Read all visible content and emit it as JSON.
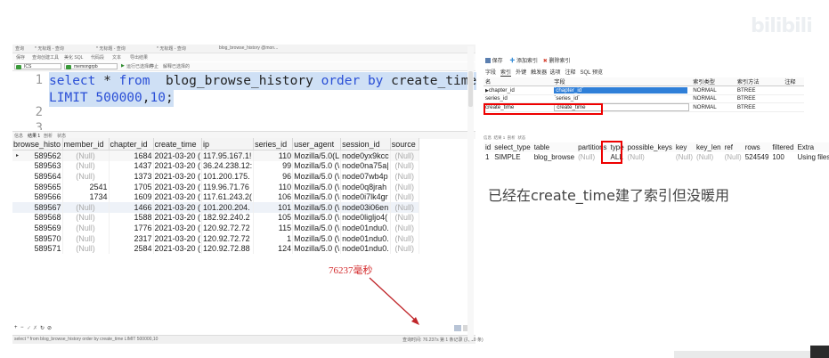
{
  "window_tabs": [
    "查询",
    "* 无标题 - 查询",
    "* 无标题 - 查询",
    "* 无标题 - 查询",
    "blog_browse_history @mon..."
  ],
  "toolbar1_items": [
    "保存",
    "查询创建工具",
    "美化 SQL",
    "代码段",
    "文本",
    "导出结果"
  ],
  "toolbar2": {
    "connection": "ICS",
    "database": "memongrpb",
    "run_label": "运行已选择的",
    "stop_label": "停止",
    "explain_label": "解释已选择的"
  },
  "editor": {
    "line_numbers": [
      "1",
      "",
      "2",
      "3"
    ],
    "line1": [
      "select",
      " * ",
      "from",
      "  blog_browse_history ",
      "order by",
      " create_time"
    ],
    "line1_wrap": [
      "LIMIT ",
      "500000",
      ",",
      "10",
      ";"
    ]
  },
  "result_tabs": [
    "信息",
    "结果 1",
    "剖析",
    "状态"
  ],
  "grid": {
    "columns": [
      "browse_histo",
      "member_id",
      "chapter_id",
      "create_time",
      "ip",
      "series_id",
      "user_agent",
      "session_id",
      "source"
    ],
    "rows": [
      [
        "589562",
        "(Null)",
        "1684",
        "2021-03-20 (",
        "117.95.167.1!",
        "110",
        "Mozilla/5.0(L",
        "node0yx9kcc",
        "(Null)"
      ],
      [
        "589563",
        "(Null)",
        "1437",
        "2021-03-20 (",
        "36.24.238.12:",
        "99",
        "Mozilla/5.0 (\\",
        "node0na75a|",
        "(Null)"
      ],
      [
        "589564",
        "(Null)",
        "1373",
        "2021-03-20 (",
        "101.200.175.",
        "96",
        "Mozilla/5.0 (\\",
        "node07wb4p",
        "(Null)"
      ],
      [
        "589565",
        "2541",
        "1705",
        "2021-03-20 (",
        "119.96.71.76",
        "110",
        "Mozilla/5.0 (\\",
        "node0q8jrah",
        "(Null)"
      ],
      [
        "589566",
        "1734",
        "1609",
        "2021-03-20 (",
        "117.61.243.2(",
        "106",
        "Mozilla/5.0 (\\",
        "node0i7lk4gr",
        "(Null)"
      ],
      [
        "589567",
        "(Null)",
        "1466",
        "2021-03-20 (",
        "101.200.204.",
        "101",
        "Mozilla/5.0 (\\",
        "node03i06en",
        "(Null)"
      ],
      [
        "589568",
        "(Null)",
        "1588",
        "2021-03-20 (",
        "182.92.240.2",
        "105",
        "Mozilla/5.0 (\\",
        "node0ligljo4(",
        "(Null)"
      ],
      [
        "589569",
        "(Null)",
        "1776",
        "2021-03-20 (",
        "120.92.72.72",
        "115",
        "Mozilla/5.0 (\\",
        "node01ndu0.",
        "(Null)"
      ],
      [
        "589570",
        "(Null)",
        "2317",
        "2021-03-20 (",
        "120.92.72.72",
        "1",
        "Mozilla/5.0 (\\",
        "node01ndu0.",
        "(Null)"
      ],
      [
        "589571",
        "(Null)",
        "2584",
        "2021-03-20 (",
        "120.92.72.88",
        "124",
        "Mozilla/5.0 (\\",
        "node01ndu0.",
        "(Null)"
      ]
    ]
  },
  "timing_annotation": "76237毫秒",
  "statusbar": {
    "sql": "select * from  blog_browse_history order by create_time LIMIT 500000,10",
    "query_time": "查询时间: 76.237s",
    "record": "第 1 条记录 (共 10 条)"
  },
  "right_toolbar": [
    "保存",
    "添加索引",
    "删除索引"
  ],
  "right_tabs": [
    "字段",
    "索引",
    "外键",
    "触发器",
    "选项",
    "注释",
    "SQL 预览"
  ],
  "index_table": {
    "columns": [
      "名",
      "字段",
      "索引类型",
      "索引方法",
      "注释"
    ],
    "rows": [
      [
        "chapter_id",
        "`chapter_id`",
        "NORMAL",
        "BTREE",
        ""
      ],
      [
        "series_id",
        "`series_id`",
        "NORMAL",
        "BTREE",
        ""
      ],
      [
        "create_time",
        "`create_time`",
        "NORMAL",
        "BTREE",
        ""
      ]
    ]
  },
  "explain_tabs": [
    "信息",
    "结果 1",
    "剖析",
    "状态"
  ],
  "explain": {
    "columns": [
      "id",
      "select_type",
      "table",
      "partitions",
      "type",
      "possible_keys",
      "key",
      "key_len",
      "ref",
      "rows",
      "filtered",
      "Extra"
    ],
    "rows": [
      [
        "1",
        "SIMPLE",
        "blog_browse",
        "(Null)",
        "ALL",
        "(Null)",
        "(Null)",
        "(Null)",
        "(Null)",
        "524549",
        "100",
        "Using filesort"
      ]
    ]
  },
  "note": "已经在create_time建了索引但没暖用",
  "watermark": "bilibili",
  "colors": {
    "keyword": "#2a4fd6",
    "selection": "#cfe0f5",
    "annotation_red": "#d3282a",
    "highlight_box": "#e00000",
    "index_highlight": "#2f7fd8"
  }
}
